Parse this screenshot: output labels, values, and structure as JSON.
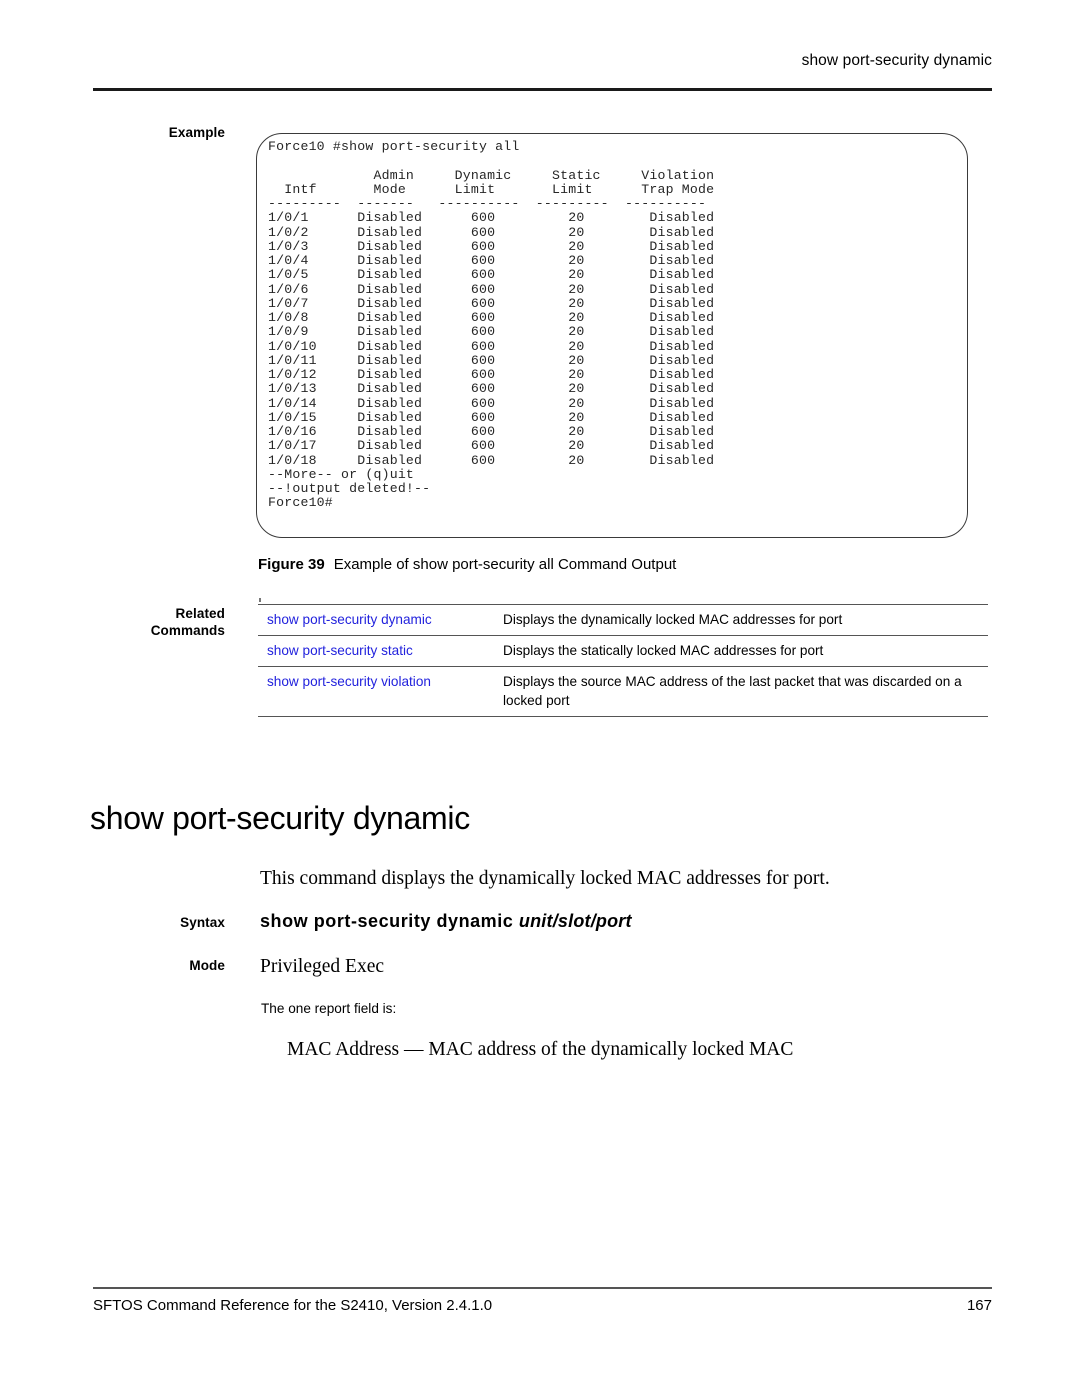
{
  "header": {
    "running_title": "show port-security dynamic"
  },
  "labels": {
    "example": "Example",
    "related_line1": "Related",
    "related_line2": "Commands",
    "syntax": "Syntax",
    "mode": "Mode"
  },
  "example": {
    "lines": [
      "Force10 #show port-security all",
      "",
      "             Admin     Dynamic     Static     Violation",
      "  Intf       Mode      Limit       Limit      Trap Mode",
      "---------  -------   ----------  ---------  ----------",
      "1/0/1      Disabled      600         20        Disabled",
      "1/0/2      Disabled      600         20        Disabled",
      "1/0/3      Disabled      600         20        Disabled",
      "1/0/4      Disabled      600         20        Disabled",
      "1/0/5      Disabled      600         20        Disabled",
      "1/0/6      Disabled      600         20        Disabled",
      "1/0/7      Disabled      600         20        Disabled",
      "1/0/8      Disabled      600         20        Disabled",
      "1/0/9      Disabled      600         20        Disabled",
      "1/0/10     Disabled      600         20        Disabled",
      "1/0/11     Disabled      600         20        Disabled",
      "1/0/12     Disabled      600         20        Disabled",
      "1/0/13     Disabled      600         20        Disabled",
      "1/0/14     Disabled      600         20        Disabled",
      "1/0/15     Disabled      600         20        Disabled",
      "1/0/16     Disabled      600         20        Disabled",
      "1/0/17     Disabled      600         20        Disabled",
      "1/0/18     Disabled      600         20        Disabled",
      "--More-- or (q)uit",
      "--!output deleted!--",
      "Force10#"
    ]
  },
  "figure": {
    "number": "Figure 39",
    "caption": "Example of show port-security all Command Output"
  },
  "related_commands": {
    "rows": [
      {
        "command": "show port-security dynamic",
        "description": "Displays the dynamically locked MAC addresses for port"
      },
      {
        "command": "show port-security static",
        "description": "Displays the statically locked MAC addresses for port"
      },
      {
        "command": "show port-security violation",
        "description": "Displays the source MAC address of the last packet that was discarded on a locked port"
      }
    ],
    "link_color": "#2222dd"
  },
  "command_section": {
    "heading": "show port-security dynamic",
    "intro": "This command displays the dynamically locked MAC addresses for port.",
    "syntax_command": "show port-security dynamic",
    "syntax_param": "unit/slot/port",
    "mode": "Privileged Exec",
    "report_intro": "The one report field is:",
    "report_field": "MAC Address — MAC address of the dynamically locked MAC"
  },
  "footer": {
    "left": "SFTOS Command Reference for the S2410, Version 2.4.1.0",
    "page_number": "167"
  }
}
